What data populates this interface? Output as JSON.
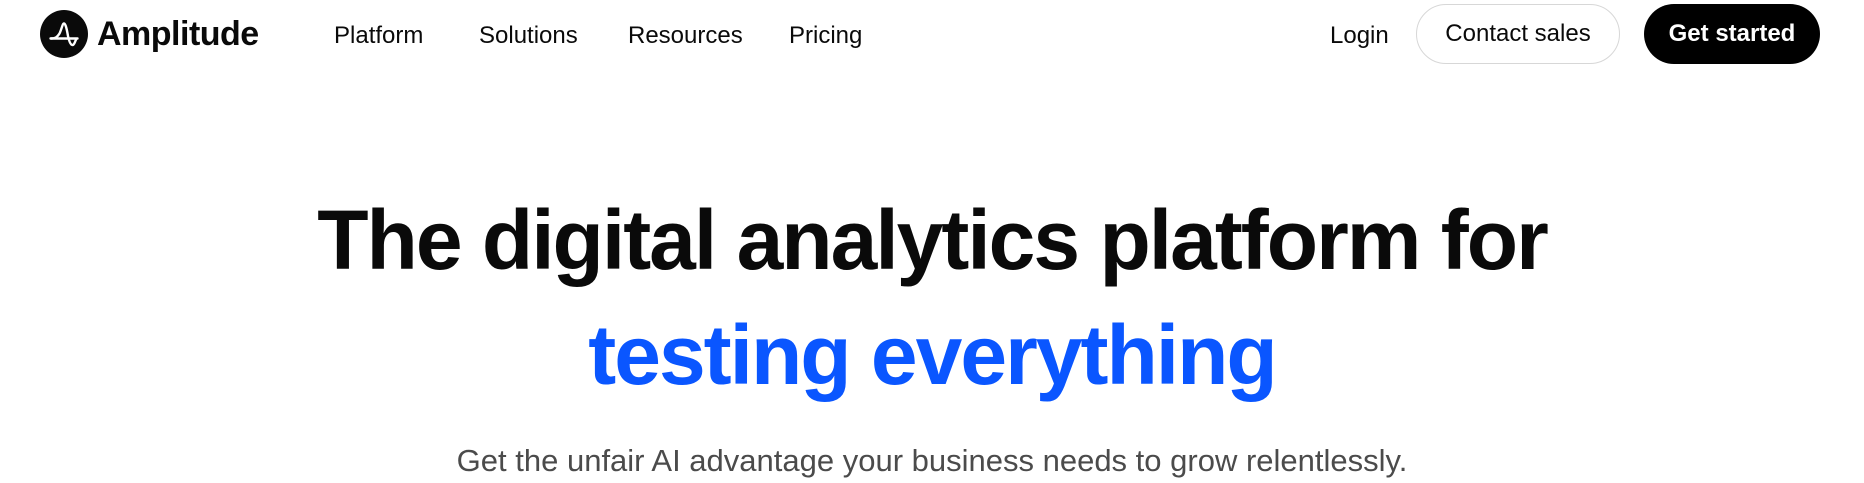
{
  "brand": {
    "name": "Amplitude",
    "logo_icon": "amplitude-wave-icon"
  },
  "nav": {
    "items": [
      {
        "label": "Platform"
      },
      {
        "label": "Solutions"
      },
      {
        "label": "Resources"
      },
      {
        "label": "Pricing"
      }
    ]
  },
  "header_actions": {
    "login_label": "Login",
    "contact_label": "Contact sales",
    "get_started_label": "Get started"
  },
  "hero": {
    "headline_line1": "The digital analytics platform for",
    "headline_line2": "testing everything",
    "subtitle": "Get the unfair AI advantage your business needs to grow relentlessly."
  },
  "colors": {
    "accent_blue": "#0a56ff",
    "text_dark": "#0a0a0a",
    "button_dark": "#000000",
    "subtitle_gray": "#4b4b4b"
  }
}
